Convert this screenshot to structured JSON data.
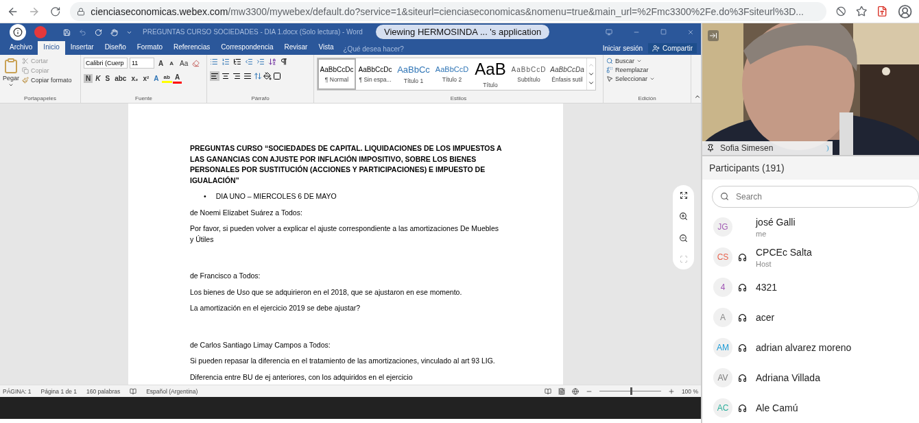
{
  "browser": {
    "url_host": "cienciaseconomicas.webex.com",
    "url_path": "/mw3300/mywebex/default.do?service=1&siteurl=cienciaseconomicas&nomenu=true&main_url=%2Fmc3300%2Fe.do%3Fsiteurl%3D..."
  },
  "word": {
    "title": "PREGUNTAS CURSO SOCIEDADES - DIA 1.docx (Solo lectura) - Word",
    "tabs": [
      {
        "label": "Archivo",
        "selected": false
      },
      {
        "label": "Inicio",
        "selected": true
      },
      {
        "label": "Insertar",
        "selected": false
      },
      {
        "label": "Diseño",
        "selected": false
      },
      {
        "label": "Formato",
        "selected": false
      },
      {
        "label": "Referencias",
        "selected": false
      },
      {
        "label": "Correspondencia",
        "selected": false
      },
      {
        "label": "Revisar",
        "selected": false
      },
      {
        "label": "Vista",
        "selected": false
      }
    ],
    "tell_me": "¿Qué desea hacer?",
    "sign_in": "Iniciar sesión",
    "share": "Compartir",
    "clipboard": {
      "paste": "Pegar",
      "cut": "Cortar",
      "copy": "Copiar",
      "format_painter": "Copiar formato",
      "label": "Portapapeles"
    },
    "font": {
      "name": "Calibri (Cuerp",
      "size": "11",
      "grow": "A",
      "shrink": "A",
      "case": "Aa",
      "format_buttons": [
        {
          "label": "N",
          "selected": true
        },
        {
          "label": "K",
          "selected": false
        },
        {
          "label": "S",
          "selected": false
        },
        {
          "label": "abc",
          "selected": false
        },
        {
          "label": "x₂",
          "selected": false
        },
        {
          "label": "x²",
          "selected": false
        }
      ],
      "effects": "A",
      "highlight": "ab",
      "color_button": "A",
      "label": "Fuente"
    },
    "paragraph": {
      "align_buttons": [
        {
          "selected": true
        },
        {
          "selected": false
        },
        {
          "selected": false
        },
        {
          "selected": false
        }
      ],
      "label": "Párrafo"
    },
    "styles": {
      "items": [
        {
          "sample": "AaBbCcDc",
          "label": "¶ Normal",
          "kind": "normal",
          "selected": true
        },
        {
          "sample": "AaBbCcDc",
          "label": "¶ Sin espa...",
          "kind": "normal",
          "selected": false
        },
        {
          "sample": "AaBbCc",
          "label": "Título 1",
          "kind": "heading1",
          "selected": false
        },
        {
          "sample": "AaBbCcD",
          "label": "Título 2",
          "kind": "heading2",
          "selected": false
        },
        {
          "sample": "AaB",
          "label": "Título",
          "kind": "title",
          "selected": false
        },
        {
          "sample": "AaBbCcD",
          "label": "Subtítulo",
          "kind": "subtitle",
          "selected": false
        },
        {
          "sample": "AaBbCcDa",
          "label": "Énfasis sutil",
          "kind": "emphasis",
          "selected": false
        }
      ],
      "label": "Estilos"
    },
    "editing": {
      "find": "Buscar",
      "replace": "Reemplazar",
      "select": "Seleccionar",
      "label": "Edición"
    },
    "document": [
      {
        "kind": "heading",
        "text": "PREGUNTAS CURSO “SOCIEDADES DE CAPITAL. LIQUIDACIONES DE LOS IMPUESTOS A LAS GANANCIAS CON AJUSTE POR INFLACIÓN IMPOSITIVO, SOBRE LOS BIENES PERSONALES POR SUSTITUCIÓN (ACCIONES Y PARTICIPACIONES) E IMPUESTO DE IGUALACIÓN”"
      },
      {
        "kind": "bullet",
        "marker": "•",
        "text": "DIA UNO – MIERCOLES 6 DE MAYO"
      },
      {
        "kind": "para",
        "text": "de Noemi Elizabet  Suárez a Todos:"
      },
      {
        "kind": "para",
        "text": "Por favor, si pueden volver a explicar el ajuste correspondiente a las amortizaciones De Muebles y Útiles"
      },
      {
        "kind": "spaced",
        "text": "de Francisco a Todos:"
      },
      {
        "kind": "line",
        "text": "Los bienes de Uso que se adquirieron en el 2018, que se ajustaron en ese momento."
      },
      {
        "kind": "para",
        "text": "La amortización en el ejercicio 2019 se debe ajustar?"
      },
      {
        "kind": "spaced",
        "text": "de Carlos Santiago Limay Campos a Todos:"
      },
      {
        "kind": "line",
        "text": "Si pueden repasar la diferencia en el tratamiento de las amortizaciones, vinculado al art 93 LIG."
      },
      {
        "kind": "para",
        "text": "Diferencia entre BU de ej anteriores, con los adquiridos  en el ejercicio"
      }
    ],
    "status": {
      "items": [
        "PÁGINA: 1",
        "Página 1 de 1",
        "160 palabras"
      ],
      "language": "Español (Argentina)",
      "zoom": {
        "level": 0.5
      },
      "zoom_reading": "100 %"
    }
  },
  "sharing_banner": "Viewing HERMOSINDA ...  's application",
  "video": {
    "name": "Sofia Simesen"
  },
  "participants": {
    "title": "Participants (191)",
    "search": {
      "placeholder": "Search"
    },
    "items": [
      {
        "initials": "JG",
        "color": "#a35fb5",
        "name": "josé Galli",
        "role": "me",
        "audio": false
      },
      {
        "initials": "CS",
        "color": "#e8624d",
        "name": "CPCEc Salta",
        "role": "Host",
        "audio": true
      },
      {
        "initials": "4",
        "color": "#a055b5",
        "name": "4321",
        "audio": true
      },
      {
        "initials": "A",
        "color": "#8a8a8a",
        "name": "acer",
        "audio": true
      },
      {
        "initials": "AM",
        "color": "#1a9ad6",
        "name": "adrian alvarez moreno",
        "audio": true
      },
      {
        "initials": "AV",
        "color": "#7a7a7a",
        "name": "Adriana Villada",
        "audio": true
      },
      {
        "initials": "AC",
        "color": "#2bae9b",
        "name": "Ale Camú",
        "audio": true
      }
    ]
  }
}
